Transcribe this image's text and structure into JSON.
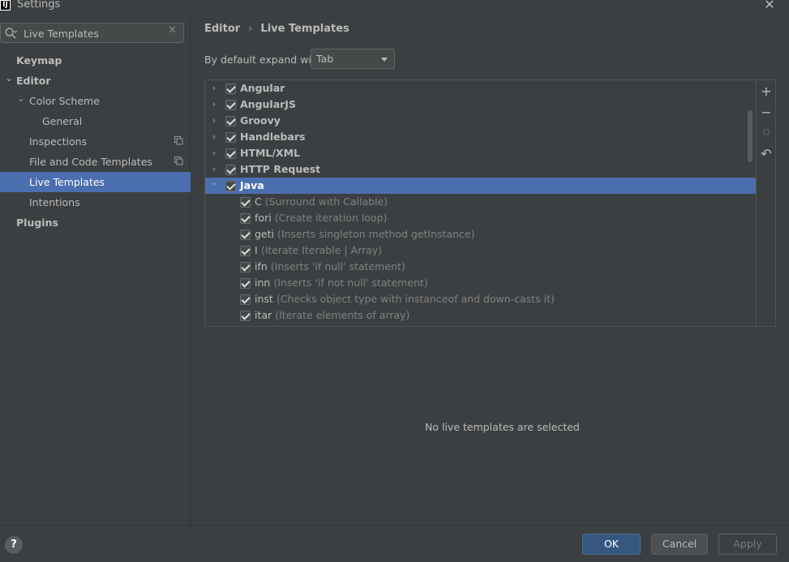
{
  "window": {
    "title": "Settings",
    "logo": "IJ"
  },
  "search": {
    "value": "Live Templates"
  },
  "sidebar": {
    "items": [
      {
        "label": "Keymap",
        "bold": true
      },
      {
        "label": "Editor",
        "bold": true,
        "expanded": true
      },
      {
        "label": "Color Scheme",
        "expanded": true
      },
      {
        "label": "General"
      },
      {
        "label": "Inspections",
        "badge": "copy-icon"
      },
      {
        "label": "File and Code Templates",
        "badge": "copy-icon"
      },
      {
        "label": "Live Templates",
        "selected": true
      },
      {
        "label": "Intentions"
      },
      {
        "label": "Plugins",
        "bold": true
      }
    ]
  },
  "breadcrumb": {
    "parent": "Editor",
    "current": "Live Templates"
  },
  "expand": {
    "label": "By default expand with",
    "value": "Tab"
  },
  "groups": [
    {
      "name": "Angular",
      "checked": true,
      "expanded": false
    },
    {
      "name": "AngularJS",
      "checked": true,
      "expanded": false
    },
    {
      "name": "Groovy",
      "checked": true,
      "expanded": false
    },
    {
      "name": "Handlebars",
      "checked": true,
      "expanded": false
    },
    {
      "name": "HTML/XML",
      "checked": true,
      "expanded": false
    },
    {
      "name": "HTTP Request",
      "checked": true,
      "expanded": false
    },
    {
      "name": "Java",
      "checked": true,
      "expanded": true,
      "selected": true
    }
  ],
  "java_templates": [
    {
      "abbr": "C",
      "desc": "(Surround with Callable)"
    },
    {
      "abbr": "fori",
      "desc": "(Create iteration loop)"
    },
    {
      "abbr": "geti",
      "desc": "(Inserts singleton method getInstance)"
    },
    {
      "abbr": "I",
      "desc": "(Iterate Iterable | Array)"
    },
    {
      "abbr": "ifn",
      "desc": "(Inserts 'if null' statement)"
    },
    {
      "abbr": "inn",
      "desc": "(Inserts 'if not null' statement)"
    },
    {
      "abbr": "inst",
      "desc": "(Checks object type with instanceof and down-casts it)"
    },
    {
      "abbr": "itar",
      "desc": "(Iterate elements of array)"
    }
  ],
  "tools": {
    "add": "+",
    "remove": "−",
    "copy": "⧉",
    "revert": "↶"
  },
  "empty_message": "No live templates are selected",
  "buttons": {
    "help": "?",
    "ok": "OK",
    "cancel": "Cancel",
    "apply": "Apply"
  },
  "colors": {
    "selection": "#4b6eaf",
    "background": "#3c3f41",
    "ok_button": "#365880"
  }
}
